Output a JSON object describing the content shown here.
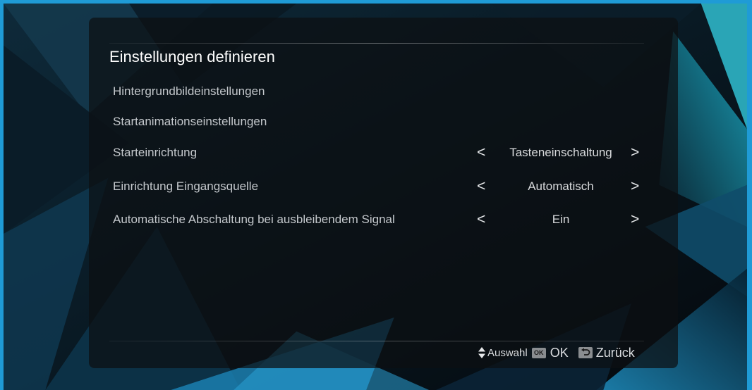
{
  "colors": {
    "border": "#1f9bd6",
    "text": "#c4c8cc",
    "title": "#ffffff"
  },
  "title": "Einstellungen definieren",
  "menu": [
    {
      "label": "Hintergrundbildeinstellungen"
    },
    {
      "label": "Startanimationseinstellungen"
    },
    {
      "label": "Starteinrichtung",
      "value": "Tasteneinschaltung"
    },
    {
      "label": "Einrichtung Eingangsquelle",
      "value": "Automatisch"
    },
    {
      "label": "Automatische Abschaltung bei ausbleibendem Signal",
      "value": "Ein"
    }
  ],
  "arrows": {
    "left": "<",
    "right": ">"
  },
  "footer": {
    "select_label": "Auswahl",
    "ok_icon_text": "OK",
    "ok_label": "OK",
    "back_label": "Zurück"
  }
}
